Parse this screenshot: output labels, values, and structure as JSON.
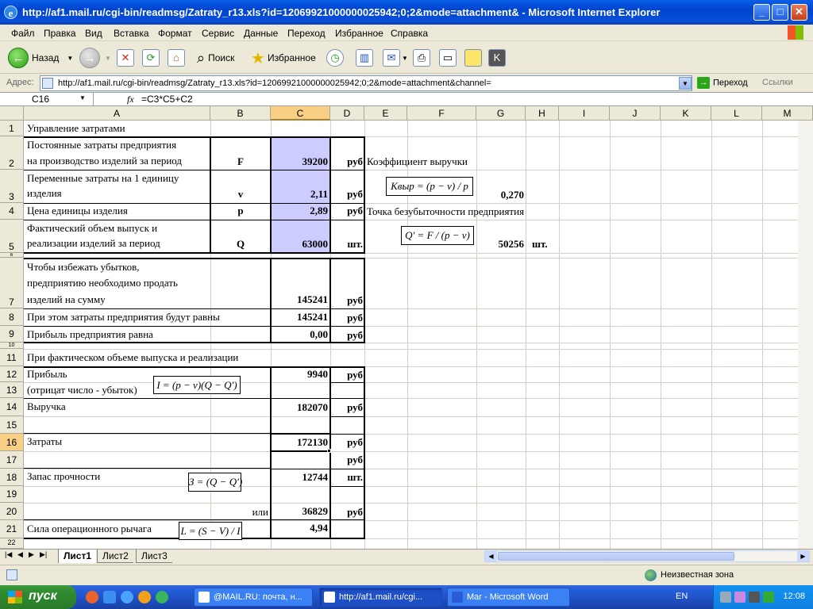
{
  "window": {
    "title": "http://af1.mail.ru/cgi-bin/readmsg/Zatraty_r13.xls?id=12069921000000025942;0;2&mode=attachment& - Microsoft Internet Explorer"
  },
  "menu": [
    "Файл",
    "Правка",
    "Вид",
    "Вставка",
    "Формат",
    "Сервис",
    "Данные",
    "Переход",
    "Избранное",
    "Справка"
  ],
  "toolbar": {
    "back": "Назад",
    "search": "Поиск",
    "favorites": "Избранное"
  },
  "address": {
    "label": "Адрес:",
    "url": "http://af1.mail.ru/cgi-bin/readmsg/Zatraty_r13.xls?id=12069921000000025942;0;2&mode=attachment&channel=",
    "go": "Переход",
    "links": "Ссылки"
  },
  "formula_bar": {
    "cell_ref": "C16",
    "fx": "fx",
    "formula": "=C3*C5+C2"
  },
  "columns": [
    "A",
    "B",
    "C",
    "D",
    "E",
    "F",
    "G",
    "H",
    "I",
    "J",
    "K",
    "L",
    "M"
  ],
  "rows": [
    "1",
    "2",
    "3",
    "4",
    "5",
    "6",
    "7",
    "8",
    "9",
    "10",
    "11",
    "12",
    "13",
    "14",
    "15",
    "16",
    "17",
    "18",
    "19",
    "20",
    "21",
    "22"
  ],
  "cells": {
    "a1": "Управление затратами",
    "a2a": "Постоянные затраты предприятия",
    "a2b": "на производство изделий за период",
    "b2": "F",
    "c2": "39200",
    "d2": "руб",
    "e2": "Коэффициент выручки",
    "a3a": "Переменные затраты на 1 единицу",
    "a3b": "изделия",
    "b3": "v",
    "c3": "2,11",
    "d3": "руб",
    "g3": "0,270",
    "a4": "Цена единицы изделия",
    "b4": "p",
    "c4": "2,89",
    "d4": "руб",
    "e4": "Точка безубыточности предприятия",
    "a5a": "Фактический объем выпуск и",
    "a5b": "реализации изделий за период",
    "b5": "Q",
    "c5": "63000",
    "d5": "шт.",
    "g5": "50256",
    "h5": "шт.",
    "a7a": "Чтобы избежать убытков,",
    "a7b": "предприятию  необходимо продать",
    "a7c": "изделий на сумму",
    "c7": "145241",
    "d7": "руб",
    "a8": "При этом затраты предприятия будут равны",
    "c8": "145241",
    "d8": "руб",
    "a9": "Прибыль предприятия равна",
    "c9": "0,00",
    "d9": "руб",
    "a11": "При фактическом объеме выпуска и реализации",
    "a12": "Прибыль",
    "c12": "9940",
    "d12": "руб",
    "a13": "(отрицат число - убыток)",
    "a14": "Выручка",
    "c14": "182070",
    "d14": "руб",
    "a16": "Затраты",
    "c16": "172130",
    "d16": "руб",
    "d17": "руб",
    "a18": "Запас прочности",
    "c18": "12744",
    "d18": "шт.",
    "b20": "или",
    "c20": "36829",
    "d20": "руб",
    "a21": "Сила операционного рычага",
    "c21": "4,94"
  },
  "formulas": {
    "kvyr": "Kвыр = (p − v) / p",
    "qbe": "Q' = F / (p − v)",
    "profit": "I = (p − v)(Q − Q')",
    "margin": "З = (Q − Q')",
    "lever": "L = (S − V) / I"
  },
  "sheets": {
    "active": "Лист1",
    "tab2": "Лист2",
    "tab3": "Лист3"
  },
  "status": {
    "zone": "Неизвестная зона"
  },
  "taskbar": {
    "start": "пуск",
    "task1": "@MAIL.RU: почта, н...",
    "task2": "http://af1.mail.ru/cgi...",
    "task3": "Mar - Microsoft Word",
    "lang": "EN",
    "clock": "12:08"
  },
  "colors": {
    "shade": "#ccccff",
    "selected_header": "#f9cf86",
    "title_bar": "#0a5fe6"
  }
}
